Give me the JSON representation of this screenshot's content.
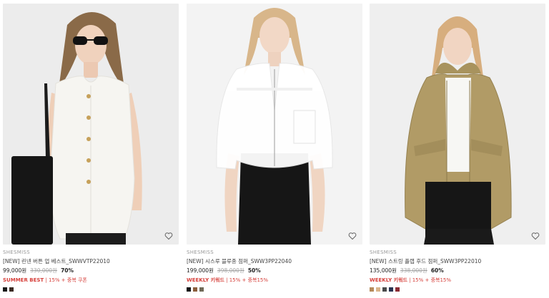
{
  "products": [
    {
      "brand": "SHESMISS",
      "name": "[NEW] 린넨 버튼 업 베스트_SWWVTP22010",
      "price": "99,000원",
      "original_price": "330,000원",
      "discount": "70%",
      "promo_keyword": "SUMMER BEST",
      "promo_rest": " | 15% + 중복 쿠폰",
      "swatches": [
        "#1a1a1a",
        "#3a2a22"
      ],
      "wishlist_icon": "heart-outline-icon"
    },
    {
      "brand": "SHESMISS",
      "name": "[NEW] 시스루 블루종 점퍼_SWW3PP22040",
      "price": "199,000원",
      "original_price": "398,000원",
      "discount": "50%",
      "promo_keyword": "WEEKLY 키워드",
      "promo_rest": " | 15% + 중복15%",
      "swatches": [
        "#151515",
        "#8b5e3c",
        "#6f6a58"
      ],
      "wishlist_icon": "heart-outline-icon"
    },
    {
      "brand": "SHESMISS",
      "name": "[NEW] 스트링 플랩 후드 점퍼_SWW3PP22010",
      "price": "135,000원",
      "original_price": "338,000원",
      "discount": "60%",
      "promo_keyword": "WEEKLY 키워드",
      "promo_rest": " | 15% + 중복15%",
      "swatches": [
        "#b58a5a",
        "#d9b48a",
        "#4a4a4a",
        "#2a3350",
        "#8b2b33"
      ],
      "wishlist_icon": "heart-outline-icon"
    }
  ],
  "colors": {
    "promo": "#d6403b",
    "brand": "#9a9a9a",
    "strikethrough": "#a5a5a5"
  }
}
